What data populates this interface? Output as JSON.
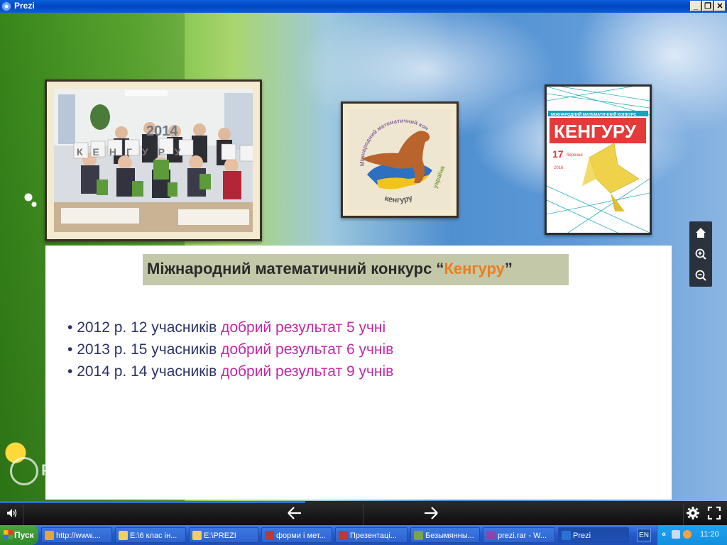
{
  "window": {
    "title": "Prezi",
    "minimize_label": "_",
    "restore_label": "❐",
    "close_label": "✕"
  },
  "slide": {
    "heading": {
      "prefix": "Міжнародний математичний конкурс “",
      "highlight": "Кенгуру",
      "suffix": "”"
    },
    "bullets": [
      {
        "normal": "2012 р. 12 учасників",
        "pink": "добрий результат 5 учні"
      },
      {
        "normal": "2013 р. 15 учасників",
        "pink": "добрий результат 6 учнів"
      },
      {
        "normal": "2014 р. 14 учасників",
        "pink": " добрий результат 9 учнів"
      }
    ],
    "photo_class_sign": "2014",
    "photo_class_word": "КЕНГУРУ",
    "logo": {
      "arc_top": "Міжнародний математичний конкурс",
      "arc_bottom": "кенгуру",
      "arc_side": "україна"
    },
    "poster": {
      "header": "МІЖНАРОДНИЙ МАТЕМАТИЧНИЙ КОНКУРС",
      "title": "КЕНГУРУ",
      "date_day": "17",
      "date_month": "березня",
      "year": "2016"
    }
  },
  "zoom_controls": {
    "home_icon": "home-icon",
    "zoom_in_icon": "zoom-in-icon",
    "zoom_out_icon": "zoom-out-icon"
  },
  "watermark": {
    "text": "Prezi"
  },
  "player": {
    "progress_fraction": 0.42
  },
  "taskbar": {
    "start_label": "Пуск",
    "tasks": [
      {
        "label": "http://www....",
        "icon_color": "#e8a33a"
      },
      {
        "label": "E:\\6 клас ін...",
        "icon_color": "#f0d060"
      },
      {
        "label": "E:\\PREZI",
        "icon_color": "#f0d060"
      },
      {
        "label": "форми і мет...",
        "icon_color": "#c0392b"
      },
      {
        "label": "Презентаці...",
        "icon_color": "#c0392b"
      },
      {
        "label": "Безымянны...",
        "icon_color": "#7aa44a"
      },
      {
        "label": "prezi.rar - W...",
        "icon_color": "#8e44ad"
      },
      {
        "label": "Prezi",
        "icon_color": "#2b73d0"
      }
    ],
    "language": "EN",
    "clock": "11:20"
  },
  "colors": {
    "heading_highlight": "#f07c1c",
    "bullet_text": "#2b3266",
    "bullet_pink": "#c428a8",
    "heading_box": "#c3c9a8",
    "progress": "#2b73d0"
  }
}
